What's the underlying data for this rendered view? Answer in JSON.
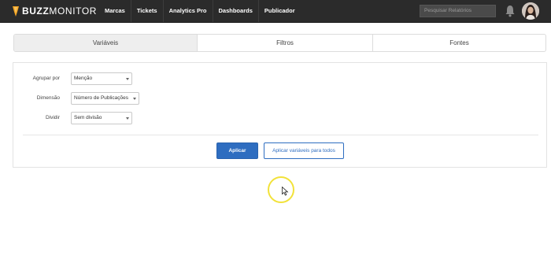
{
  "app": {
    "logo_bold": "BUZZ",
    "logo_light": "MONITOR",
    "brand_color": "#f5a623"
  },
  "nav": {
    "items": [
      {
        "label": "Marcas"
      },
      {
        "label": "Tickets"
      },
      {
        "label": "Analytics Pro"
      },
      {
        "label": "Dashboards"
      },
      {
        "label": "Publicador"
      }
    ]
  },
  "search": {
    "placeholder": "Pesquisar Relatórios"
  },
  "icons": {
    "bell": "bell-icon",
    "avatar": "user-avatar"
  },
  "tabs": [
    {
      "label": "Variáveis",
      "active": true
    },
    {
      "label": "Filtros",
      "active": false
    },
    {
      "label": "Fontes",
      "active": false
    }
  ],
  "form": {
    "rows": [
      {
        "label": "Agrupar por",
        "value": "Menção"
      },
      {
        "label": "Dimensão",
        "value": "Número de Publicações"
      },
      {
        "label": "Dividir",
        "value": "Sem divisão"
      }
    ]
  },
  "actions": {
    "apply_label": "Aplicar",
    "apply_all_label": "Aplicar variáveis para todos",
    "accent_color": "#2e6dc0"
  }
}
